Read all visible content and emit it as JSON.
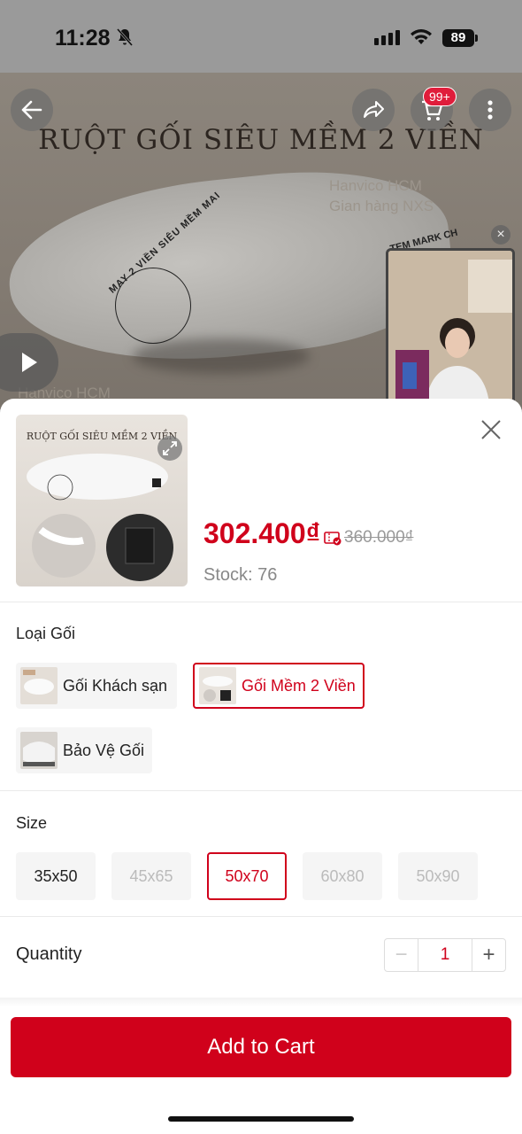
{
  "status": {
    "time": "11:28",
    "battery": "89"
  },
  "hero": {
    "title": "RUỘT GỐI SIÊU MỀM 2 VIỀN",
    "brand_line1": "Hanvico HCM",
    "brand_line2": "Gian hàng NXS",
    "curve_text": "MAY 2 VIỀN SIÊU MỀM MAI",
    "tem_text": "TEM MARK CH",
    "faded_brand": "Hanvico HCM",
    "cart_badge": "99+"
  },
  "product": {
    "thumb_title": "RUỘT GỐI SIÊU MỀM 2 VIỀN",
    "price": "302.400₫",
    "old_price": "360.000₫",
    "stock": "Stock: 76"
  },
  "variant": {
    "label": "Loại Gối",
    "options": [
      {
        "label": "Gối Khách sạn"
      },
      {
        "label": "Gối Mềm 2 Viền"
      },
      {
        "label": "Bảo Vệ Gối"
      }
    ]
  },
  "size": {
    "label": "Size",
    "options": [
      "35x50",
      "45x65",
      "50x70",
      "60x80",
      "50x90"
    ]
  },
  "quantity": {
    "label": "Quantity",
    "value": "1",
    "minus": "−",
    "plus": "+"
  },
  "cta": {
    "add_to_cart": "Add to Cart"
  },
  "colors": {
    "accent": "#d0011b",
    "badge": "#e01d3b"
  }
}
